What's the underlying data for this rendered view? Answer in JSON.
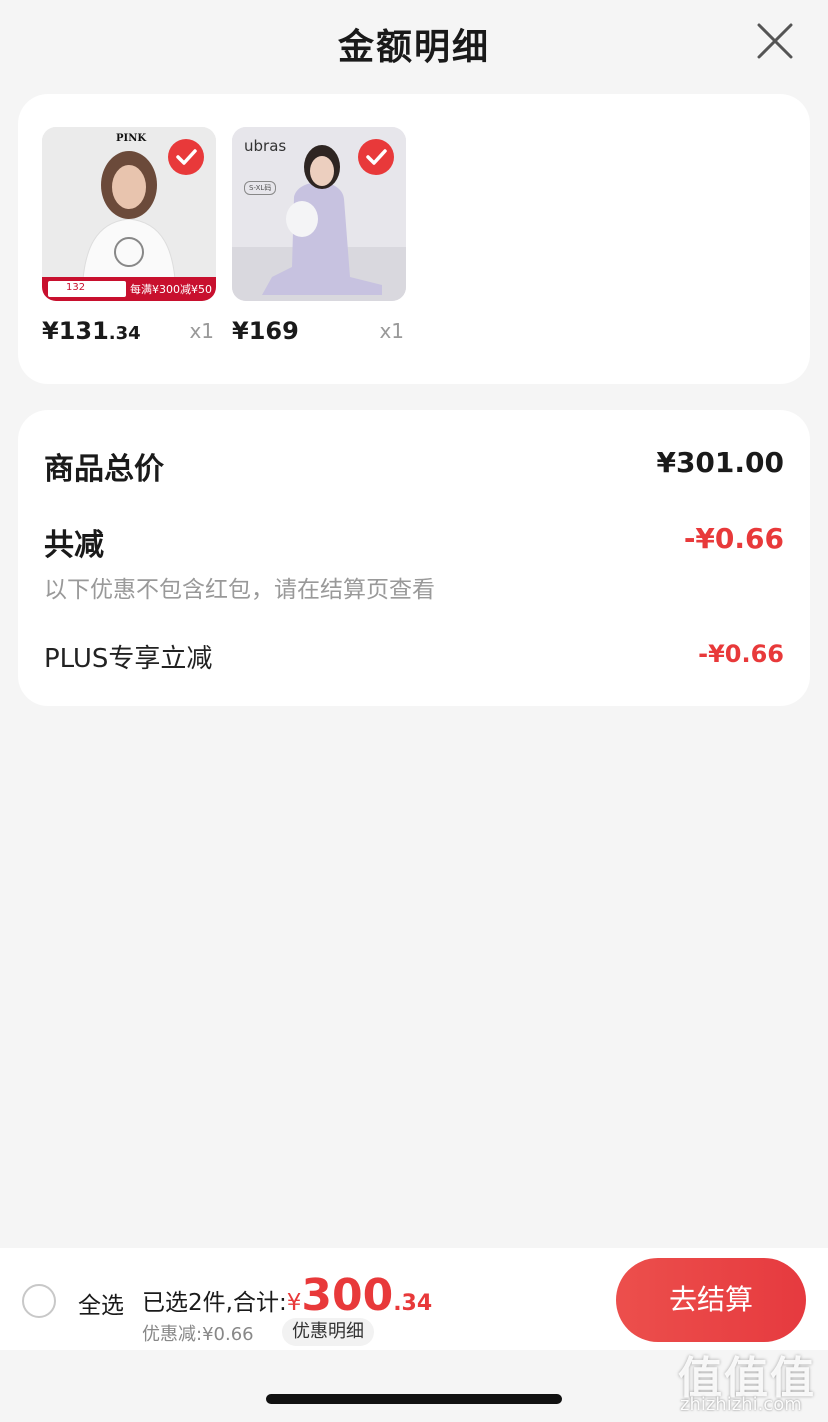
{
  "header": {
    "title": "金额明细",
    "close_icon": "close-icon"
  },
  "products": [
    {
      "brand": "PINK",
      "promo_price": "132",
      "promo_text": "每满¥300减¥50",
      "price_int": "¥131",
      "price_dec": ".34",
      "qty": "x1",
      "selected": true
    },
    {
      "brand": "ubras",
      "size_tag": "S-XL码",
      "price_int": "¥169",
      "price_dec": "",
      "qty": "x1",
      "selected": true
    }
  ],
  "summary": {
    "goods_total_label": "商品总价",
    "goods_total_value": "¥301.00",
    "discount_label": "共减",
    "discount_value": "-¥0.66",
    "discount_note": "以下优惠不包含红包，请在结算页查看",
    "plus_label": "PLUS专享立减",
    "plus_value": "-¥0.66"
  },
  "bottom": {
    "select_all": "全选",
    "total_label": "已选2件,合计:",
    "yen": "¥",
    "total_int": "300",
    "total_dec": ".34",
    "discount_line": "优惠减:¥0.66",
    "detail_chip": "优惠明细",
    "checkout": "去结算"
  },
  "watermark": {
    "logo": "值值值",
    "url": "zhizhizhi.com"
  },
  "colors": {
    "accent": "#e8393a",
    "background": "#f5f5f5"
  }
}
